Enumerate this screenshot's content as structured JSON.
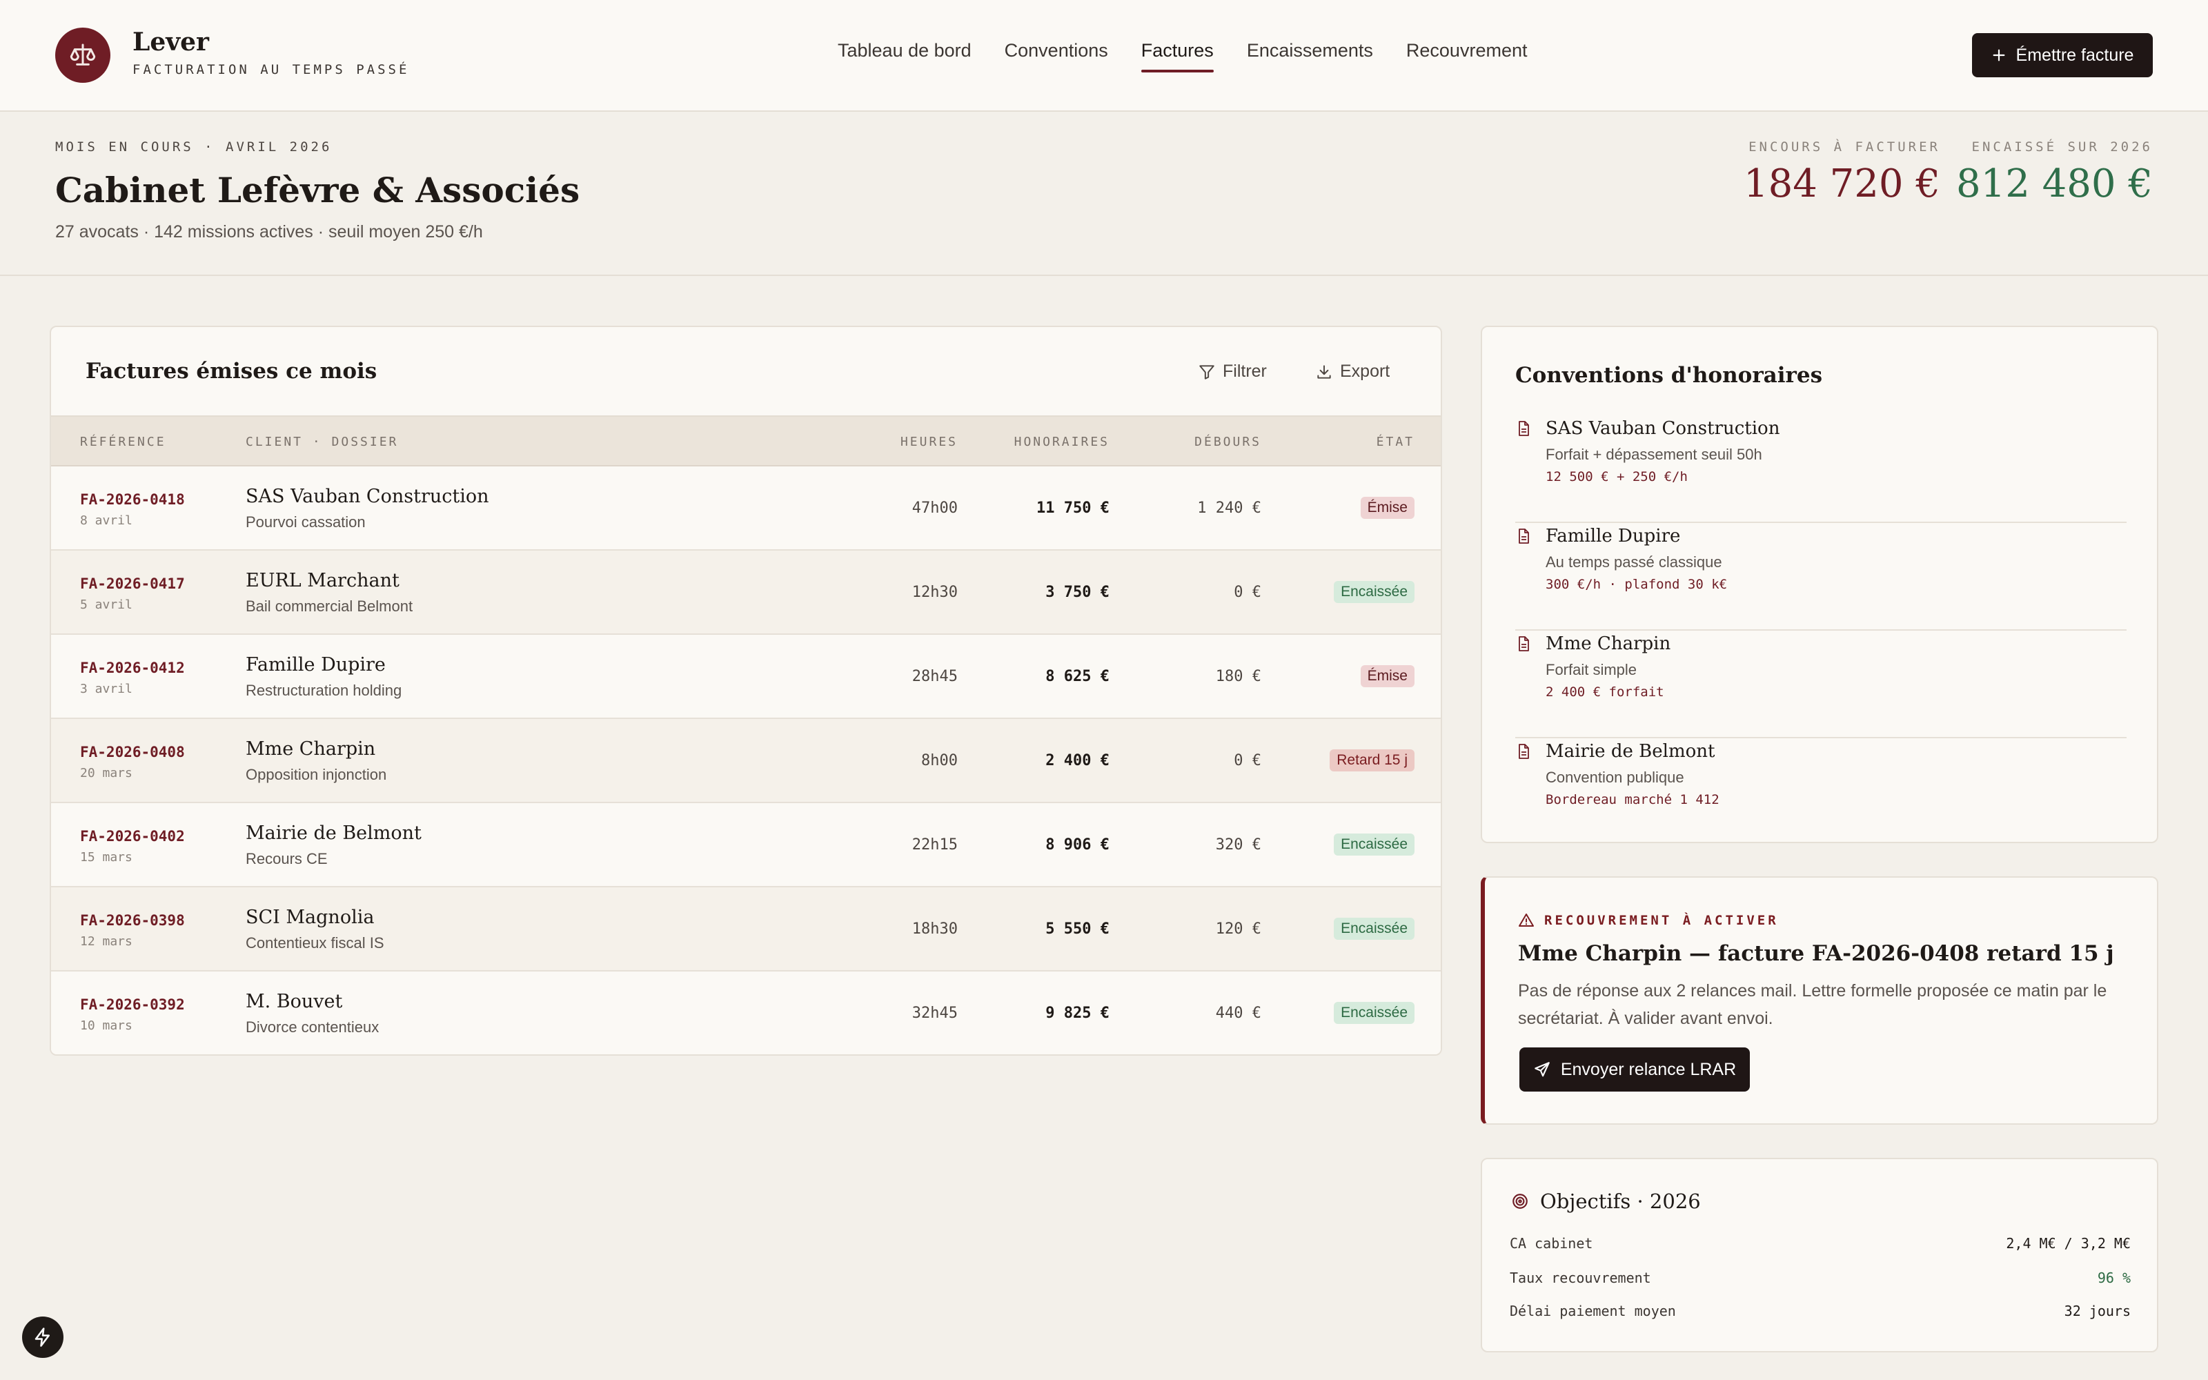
{
  "app": {
    "brand_name": "Lever",
    "brand_subtitle": "FACTURATION AU TEMPS PASSÉ",
    "logo_icon": "scales-icon"
  },
  "nav": {
    "items": [
      {
        "label": "Tableau de bord",
        "active": false
      },
      {
        "label": "Conventions",
        "active": false
      },
      {
        "label": "Factures",
        "active": true
      },
      {
        "label": "Encaissements",
        "active": false
      },
      {
        "label": "Recouvrement",
        "active": false
      }
    ],
    "emit_button": "Émettre facture"
  },
  "summary": {
    "period": "MOIS EN COURS · AVRIL 2026",
    "firm": "Cabinet Lefèvre & Associés",
    "meta": "27 avocats · 142 missions actives · seuil moyen 250 €/h",
    "kpis": [
      {
        "label": "ENCOURS À FACTURER",
        "value": "184 720 €",
        "color": "#6f1d25"
      },
      {
        "label": "ENCAISSÉ SUR 2026",
        "value": "812 480 €",
        "color": "#2f6e4a"
      }
    ]
  },
  "invoices": {
    "title": "Factures émises ce mois",
    "filter_label": "Filtrer",
    "export_label": "Export",
    "columns": {
      "ref": "RÉFÉRENCE",
      "client": "CLIENT · DOSSIER",
      "hours": "HEURES",
      "fees": "HONORAIRES",
      "debours": "DÉBOURS",
      "state": "ÉTAT"
    },
    "rows": [
      {
        "ref": "FA-2026-0418",
        "date": "8 avril",
        "client": "SAS Vauban Construction",
        "dossier": "Pourvoi cassation",
        "hours": "47h00",
        "fees": "11 750 €",
        "debours": "1 240 €",
        "state": "Émise",
        "kind": "emise"
      },
      {
        "ref": "FA-2026-0417",
        "date": "5 avril",
        "client": "EURL Marchant",
        "dossier": "Bail commercial Belmont",
        "hours": "12h30",
        "fees": "3 750 €",
        "debours": "0 €",
        "state": "Encaissée",
        "kind": "enc"
      },
      {
        "ref": "FA-2026-0412",
        "date": "3 avril",
        "client": "Famille Dupire",
        "dossier": "Restructuration holding",
        "hours": "28h45",
        "fees": "8 625 €",
        "debours": "180 €",
        "state": "Émise",
        "kind": "emise"
      },
      {
        "ref": "FA-2026-0408",
        "date": "20 mars",
        "client": "Mme Charpin",
        "dossier": "Opposition injonction",
        "hours": "8h00",
        "fees": "2 400 €",
        "debours": "0 €",
        "state": "Retard 15 j",
        "kind": "late"
      },
      {
        "ref": "FA-2026-0402",
        "date": "15 mars",
        "client": "Mairie de Belmont",
        "dossier": "Recours CE",
        "hours": "22h15",
        "fees": "8 906 €",
        "debours": "320 €",
        "state": "Encaissée",
        "kind": "enc"
      },
      {
        "ref": "FA-2026-0398",
        "date": "12 mars",
        "client": "SCI Magnolia",
        "dossier": "Contentieux fiscal IS",
        "hours": "18h30",
        "fees": "5 550 €",
        "debours": "120 €",
        "state": "Encaissée",
        "kind": "enc"
      },
      {
        "ref": "FA-2026-0392",
        "date": "10 mars",
        "client": "M. Bouvet",
        "dossier": "Divorce contentieux",
        "hours": "32h45",
        "fees": "9 825 €",
        "debours": "440 €",
        "state": "Encaissée",
        "kind": "enc"
      }
    ]
  },
  "conventions": {
    "title": "Conventions d'honoraires",
    "items": [
      {
        "name": "SAS Vauban Construction",
        "desc": "Forfait + dépassement seuil 50h",
        "terms": "12 500 € + 250 €/h"
      },
      {
        "name": "Famille Dupire",
        "desc": "Au temps passé classique",
        "terms": "300 €/h · plafond 30 k€"
      },
      {
        "name": "Mme Charpin",
        "desc": "Forfait simple",
        "terms": "2 400 € forfait"
      },
      {
        "name": "Mairie de Belmont",
        "desc": "Convention publique",
        "terms": "Bordereau marché 1 412"
      }
    ]
  },
  "alert": {
    "eyebrow": "RECOUVREMENT À ACTIVER",
    "title": "Mme Charpin — facture FA-2026-0408 retard 15 j",
    "body": "Pas de réponse aux 2 relances mail. Lettre formelle proposée ce matin par le secrétariat. À valider avant envoi.",
    "button": "Envoyer relance LRAR"
  },
  "objectives": {
    "title": "Objectifs · 2026",
    "rows": [
      {
        "label": "CA cabinet",
        "value": "2,4 M€ / 3,2 M€",
        "highlight": false
      },
      {
        "label": "Taux recouvrement",
        "value": "96 %",
        "highlight": true
      },
      {
        "label": "Délai paiement moyen",
        "value": "32 jours",
        "highlight": false
      }
    ]
  }
}
